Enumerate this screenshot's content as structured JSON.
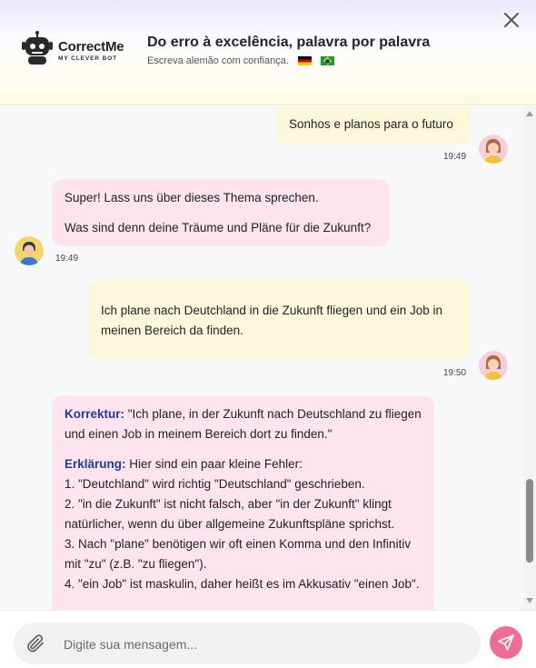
{
  "header": {
    "logo_name": "CorrectMe",
    "logo_tagline": "MY CLEVER BOT",
    "title": "Do erro à excelência, palavra por palavra",
    "subtitle": "Escreva alemão com confiança."
  },
  "messages": [
    {
      "from": "user",
      "text": "Sonhos e planos para o futuro",
      "time": "19:49"
    },
    {
      "from": "bot",
      "lines": [
        "Super! Lass uns über dieses Thema sprechen.",
        "Was sind denn deine Träume und Pläne für die Zukunft?"
      ],
      "time": "19:49"
    },
    {
      "from": "user",
      "text": "Ich plane nach Deutchland in die Zukunft fliegen und ein Job in meinen Bereich da finden.",
      "time": "19:50"
    },
    {
      "from": "bot",
      "correction_label": "Korrektur:",
      "correction_text": " \"Ich plane, in der Zukunft nach Deutschland zu fliegen und einen Job in meinem Bereich dort zu finden.\"",
      "explanation_label": "Erklärung:",
      "explanation_text": " Hier sind ein paar kleine Fehler:",
      "points": [
        "1. \"Deutchland\" wird richtig \"Deutschland\" geschrieben.",
        "2. \"in die Zukunft\" ist nicht falsch, aber \"in der Zukunft\" klingt natürlicher, wenn du über allgemeine Zukunftspläne sprichst.",
        "3. Nach \"plane\" benötigen wir oft einen Komma und den Infinitiv mit \"zu\" (z.B. \"zu fliegen\").",
        "4. \"ein Job\" ist maskulin, daher heißt es im Akkusativ \"einen Job\"."
      ]
    }
  ],
  "composer": {
    "placeholder": "Digite sua mensagem..."
  },
  "icons": {
    "close": "close-icon",
    "attach": "paperclip-icon",
    "send": "send-icon"
  },
  "colors": {
    "user_bubble": "#fdf8dc",
    "bot_bubble": "#fde4ee",
    "accent": "#ee6d97",
    "highlight": "#1f3aa6"
  }
}
